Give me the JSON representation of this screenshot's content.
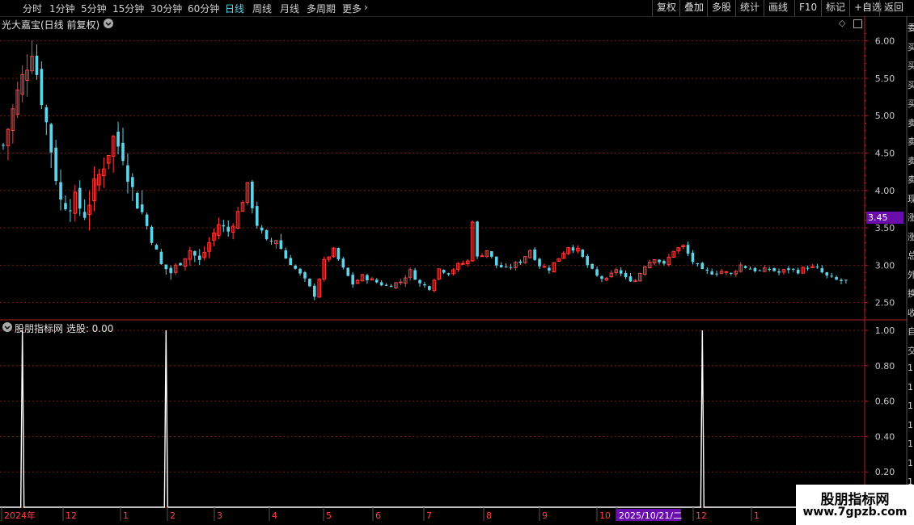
{
  "toolbar": {
    "periods": [
      "分时",
      "1分钟",
      "5分钟",
      "15分钟",
      "30分钟",
      "60分钟",
      "日线",
      "周线",
      "月线",
      "多周期",
      "更多"
    ],
    "active_period": "日线",
    "more_icon": "chevron-right-icon",
    "right_buttons": [
      "复权",
      "叠加",
      "多股",
      "统计",
      "画线",
      "F10",
      "标记",
      "+自选",
      "返回"
    ]
  },
  "main_panel": {
    "title": "光大嘉宝(日线 前复权)",
    "title_icon": "chevron-down-icon",
    "corner_icon": "diamond-icon",
    "current_price_tag": "3.45",
    "current_price_tag_color": "#6a0dad"
  },
  "indicator_panel": {
    "title": "股朋指标网 选股: 0.00",
    "title_icon": "chevron-down-icon"
  },
  "x_axis": {
    "labels": [
      "2024年",
      "12",
      "1",
      "2",
      "3",
      "4",
      "5",
      "6",
      "7",
      "8",
      "9",
      "10",
      "2025/10/21/二",
      "12",
      "1"
    ],
    "highlight_label": "2025/10/21/二"
  },
  "watermark": {
    "title": "股朋指标网",
    "url": "www.7gpzb.com"
  },
  "right_edge_glyphs": [
    "委",
    "买",
    "买",
    "买",
    "买",
    "卖",
    "卖",
    "卖",
    "卖",
    "现",
    "涨",
    "涨",
    "总",
    "外",
    "换",
    "收",
    "自",
    "交",
    "1",
    "1",
    "1",
    "1",
    "1",
    "1",
    "1"
  ],
  "colors": {
    "up": "#ff3d3d",
    "down": "#5fd4e8",
    "grid": "#7a1a1a",
    "axis": "#b02020",
    "signal": "#ffffff",
    "active_tab": "#5fd4e8"
  },
  "chart_data": [
    {
      "type": "candlestick",
      "title": "光大嘉宝(日线 前复权)",
      "y_ticks": [
        6.0,
        5.5,
        5.0,
        4.5,
        4.0,
        3.5,
        3.0,
        2.5
      ],
      "y_tick_labels": [
        "6.00",
        "5.50",
        "5.00",
        "4.50",
        "4.00",
        "3.50",
        "3.00",
        "2.50"
      ],
      "ylim": [
        2.28,
        6.18
      ],
      "x_tick_labels": [
        "2024年",
        "12",
        "1",
        "2",
        "3",
        "4",
        "5",
        "6",
        "7",
        "8",
        "9",
        "10",
        "2025/10/21/二",
        "12",
        "1"
      ],
      "last_close": 3.45,
      "close_path": [
        [
          0,
          4.6
        ],
        [
          3,
          5.3
        ],
        [
          6,
          5.9
        ],
        [
          9,
          4.9
        ],
        [
          12,
          3.85
        ],
        [
          15,
          3.85
        ],
        [
          17,
          3.7
        ],
        [
          20,
          4.2
        ],
        [
          23,
          4.7
        ],
        [
          25,
          4.5
        ],
        [
          27,
          4.0
        ],
        [
          29,
          3.7
        ],
        [
          31,
          3.35
        ],
        [
          33,
          3.0
        ],
        [
          35,
          2.9
        ],
        [
          37,
          3.05
        ],
        [
          39,
          3.2
        ],
        [
          41,
          3.05
        ],
        [
          43,
          3.3
        ],
        [
          45,
          3.55
        ],
        [
          47,
          3.45
        ],
        [
          49,
          3.7
        ],
        [
          51,
          4.05
        ],
        [
          53,
          3.55
        ],
        [
          55,
          3.3
        ],
        [
          57,
          3.35
        ],
        [
          59,
          3.1
        ],
        [
          61,
          2.95
        ],
        [
          63,
          2.8
        ],
        [
          65,
          2.6
        ],
        [
          67,
          3.05
        ],
        [
          69,
          3.2
        ],
        [
          71,
          2.95
        ],
        [
          73,
          2.75
        ],
        [
          75,
          2.85
        ],
        [
          77,
          2.8
        ],
        [
          80,
          2.72
        ],
        [
          83,
          2.78
        ],
        [
          85,
          2.92
        ],
        [
          87,
          2.75
        ],
        [
          89,
          2.7
        ],
        [
          91,
          2.95
        ],
        [
          93,
          2.9
        ],
        [
          95,
          3.0
        ],
        [
          97,
          3.05
        ],
        [
          98,
          3.6
        ],
        [
          99,
          3.1
        ],
        [
          101,
          3.2
        ],
        [
          103,
          3.0
        ],
        [
          105,
          2.95
        ],
        [
          108,
          3.05
        ],
        [
          110,
          3.2
        ],
        [
          112,
          3.0
        ],
        [
          114,
          2.95
        ],
        [
          116,
          3.1
        ],
        [
          118,
          3.25
        ],
        [
          120,
          3.2
        ],
        [
          122,
          3.0
        ],
        [
          124,
          2.85
        ],
        [
          126,
          2.8
        ],
        [
          128,
          2.95
        ],
        [
          130,
          2.82
        ],
        [
          132,
          2.8
        ],
        [
          134,
          3.0
        ],
        [
          136,
          3.1
        ],
        [
          138,
          3.0
        ],
        [
          140,
          3.2
        ],
        [
          142,
          3.25
        ],
        [
          144,
          3.05
        ],
        [
          146,
          2.92
        ],
        [
          148,
          2.9
        ],
        [
          150,
          2.92
        ],
        [
          152,
          2.88
        ],
        [
          154,
          3.0
        ],
        [
          156,
          2.95
        ],
        [
          158,
          2.92
        ],
        [
          160,
          2.95
        ],
        [
          162,
          2.9
        ],
        [
          164,
          2.95
        ],
        [
          166,
          2.92
        ],
        [
          168,
          2.98
        ],
        [
          170,
          2.95
        ],
        [
          172,
          2.85
        ],
        [
          174,
          2.8
        ],
        [
          176,
          2.78
        ]
      ],
      "candle_count": 177
    },
    {
      "type": "line",
      "title": "股朋指标网 选股: 0.00",
      "series": [
        {
          "name": "选股",
          "spike_indices": [
            4,
            34,
            146
          ],
          "baseline": 0,
          "spike_value": 1.0
        }
      ],
      "y_ticks": [
        1.0,
        0.8,
        0.6,
        0.4,
        0.2
      ],
      "y_tick_labels": [
        "1.00",
        "0.80",
        "0.60",
        "0.40",
        "0.20"
      ],
      "ylim": [
        0,
        1.05
      ]
    }
  ]
}
